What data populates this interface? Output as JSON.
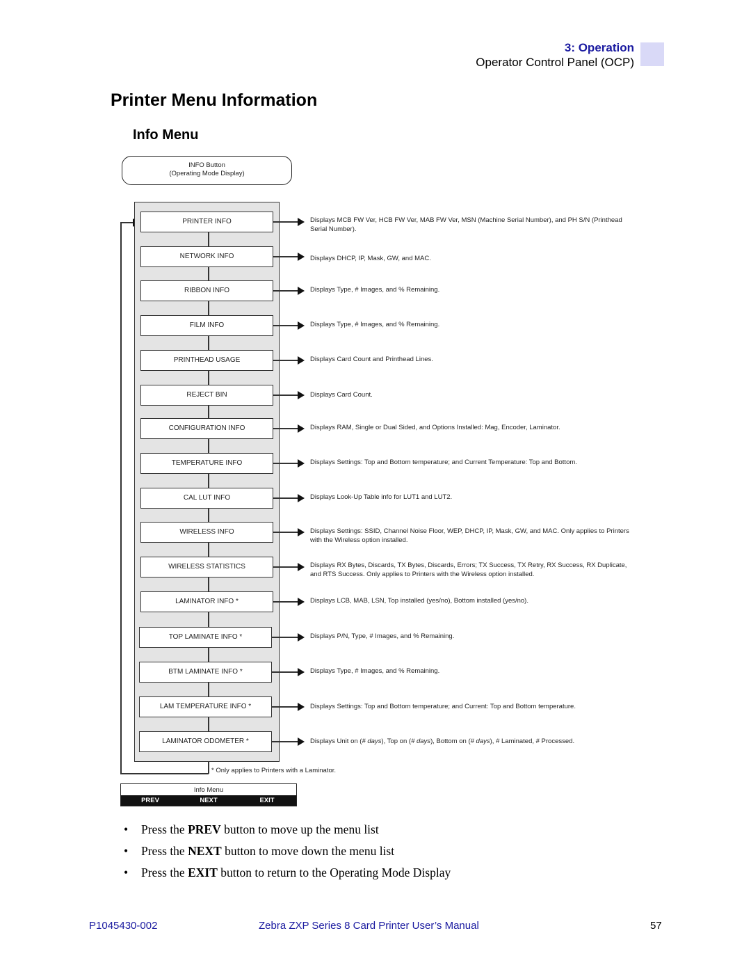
{
  "header": {
    "chapter": "3: Operation",
    "section": "Operator Control Panel (OCP)",
    "tab_color": "#d9d9f7",
    "chapter_color": "#1a1aa0"
  },
  "page_title": "Printer Menu Information",
  "sub_title": "Info Menu",
  "diagram": {
    "start_node": {
      "line1": "INFO Button",
      "line2": "(Operating Mode Display)"
    },
    "items": [
      {
        "label": "PRINTER INFO",
        "description": "Displays MCB FW Ver, HCB FW Ver, MAB FW Ver, MSN (Machine Serial Number), and PH S/N (Printhead Serial Number)."
      },
      {
        "label": "NETWORK INFO",
        "description": "Displays DHCP, IP, Mask, GW, and MAC."
      },
      {
        "label": "RIBBON INFO",
        "description": "Displays Type, # Images, and % Remaining."
      },
      {
        "label": "FILM INFO",
        "description": "Displays Type, # Images, and % Remaining."
      },
      {
        "label": "PRINTHEAD USAGE",
        "description": "Displays Card Count and Printhead Lines."
      },
      {
        "label": "REJECT BIN",
        "description": "Displays Card Count."
      },
      {
        "label": "CONFIGURATION INFO",
        "description": "Displays RAM, Single or Dual Sided, and Options Installed: Mag, Encoder, Laminator."
      },
      {
        "label": "TEMPERATURE INFO",
        "description": "Displays Settings: Top and Bottom temperature; and Current Temperature: Top and Bottom."
      },
      {
        "label": "CAL LUT INFO",
        "description": "Displays Look-Up Table info for LUT1 and LUT2."
      },
      {
        "label": "WIRELESS INFO",
        "description": "Displays Settings: SSID, Channel Noise Floor, WEP, DHCP, IP, Mask, GW, and MAC. Only applies to Printers with the Wireless option installed."
      },
      {
        "label": "WIRELESS STATISTICS",
        "description": "Displays RX Bytes, Discards, TX Bytes, Discards, Errors; TX Success, TX Retry, RX Success, RX Duplicate, and RTS Success. Only applies to Printers with the Wireless option installed."
      },
      {
        "label": "LAMINATOR INFO *",
        "description": "Displays LCB, MAB, LSN, Top installed (yes/no), Bottom installed (yes/no)."
      },
      {
        "label": "TOP LAMINATE INFO *",
        "description": "Displays P/N, Type, # Images, and % Remaining."
      },
      {
        "label": "BTM LAMINATE INFO *",
        "description": "Displays Type, # Images, and % Remaining."
      },
      {
        "label": "LAM TEMPERATURE INFO *",
        "description": "Displays Settings: Top and Bottom temperature; and Current: Top and Bottom temperature."
      },
      {
        "label": "LAMINATOR ODOMETER *",
        "description": "Displays Unit on (# days), Top on (# days), Bottom on (# days), # Laminated, # Processed."
      }
    ],
    "footnote": "* Only applies to Printers with a Laminator."
  },
  "lcd": {
    "title": "Info Menu",
    "buttons": [
      "PREV",
      "NEXT",
      "EXIT"
    ]
  },
  "bullets": [
    {
      "pre": "Press the ",
      "bold": "PREV",
      "post": " button to move up the menu list"
    },
    {
      "pre": "Press the ",
      "bold": "NEXT",
      "post": " button to move down the menu list"
    },
    {
      "pre": "Press the ",
      "bold": "EXIT",
      "post": " button to return to the Operating Mode Display"
    }
  ],
  "footer": {
    "doc_number": "P1045430-002",
    "manual_title": "Zebra ZXP Series 8 Card Printer User’s Manual",
    "page_number": "57"
  }
}
